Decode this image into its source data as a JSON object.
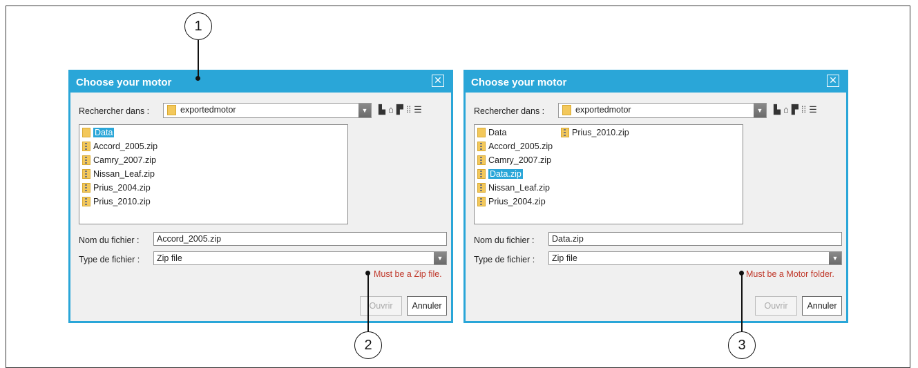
{
  "callouts": [
    "1",
    "2",
    "3"
  ],
  "dialogs": [
    {
      "title": "Choose your motor",
      "look_in_label": "Rechercher dans :",
      "look_in_value": "exportedmotor",
      "files": [
        {
          "name": "Data",
          "type": "folder",
          "selected": true
        },
        {
          "name": "Accord_2005.zip",
          "type": "zip"
        },
        {
          "name": "Camry_2007.zip",
          "type": "zip"
        },
        {
          "name": "Nissan_Leaf.zip",
          "type": "zip"
        },
        {
          "name": "Prius_2004.zip",
          "type": "zip"
        },
        {
          "name": "Prius_2010.zip",
          "type": "zip"
        }
      ],
      "filename_label": "Nom du fichier :",
      "filename_value": "Accord_2005.zip",
      "filetype_label": "Type de fichier :",
      "filetype_value": "Zip file",
      "error": "Must be a Zip file.",
      "open_label": "Ouvrir",
      "cancel_label": "Annuler"
    },
    {
      "title": "Choose your motor",
      "look_in_label": "Rechercher dans :",
      "look_in_value": "exportedmotor",
      "files": [
        {
          "name": "Data",
          "type": "folder"
        },
        {
          "name": "Accord_2005.zip",
          "type": "zip"
        },
        {
          "name": "Camry_2007.zip",
          "type": "zip"
        },
        {
          "name": "Data.zip",
          "type": "zip",
          "selected": true
        },
        {
          "name": "Nissan_Leaf.zip",
          "type": "zip"
        },
        {
          "name": "Prius_2004.zip",
          "type": "zip"
        },
        {
          "name": "Prius_2010.zip",
          "type": "zip"
        }
      ],
      "filename_label": "Nom du fichier :",
      "filename_value": "Data.zip",
      "filetype_label": "Type de fichier :",
      "filetype_value": "Zip file",
      "error": "Must be a Motor folder.",
      "open_label": "Ouvrir",
      "cancel_label": "Annuler"
    }
  ],
  "toolbar_icons": [
    "up-folder-icon",
    "home-icon",
    "new-folder-icon",
    "list-view-icon",
    "details-view-icon"
  ]
}
